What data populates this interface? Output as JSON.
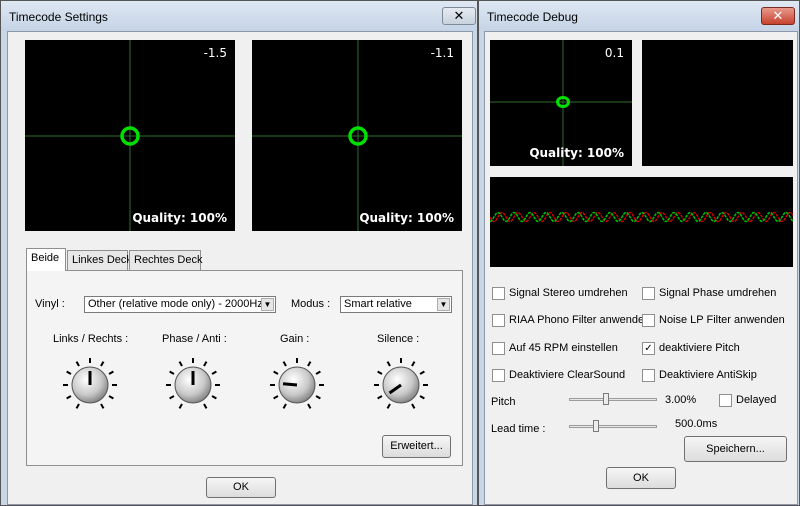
{
  "settings": {
    "title": "Timecode Settings",
    "close_glyph": "✕",
    "scope_left": {
      "value": "-1.5",
      "quality": "Quality: 100%"
    },
    "scope_right": {
      "value": "-1.1",
      "quality": "Quality: 100%"
    },
    "tabs": [
      "Beide",
      "Linkes Deck",
      "Rechtes Deck"
    ],
    "vinyl_label": "Vinyl :",
    "vinyl_value": "Other (relative mode only) - 2000Hz",
    "modus_label": "Modus :",
    "modus_value": "Smart relative",
    "knobs": [
      {
        "label": "Links / Rechts :"
      },
      {
        "label": "Phase / Anti :"
      },
      {
        "label": "Gain :"
      },
      {
        "label": "Silence :"
      }
    ],
    "advanced_button": "Erweitert...",
    "ok_button": "OK"
  },
  "debug": {
    "title": "Timecode Debug",
    "close_glyph": "✕",
    "scope": {
      "value": "0.1",
      "quality": "Quality: 100%"
    },
    "checkboxes": [
      {
        "label": "Signal Stereo umdrehen",
        "checked": false
      },
      {
        "label": "Signal Phase umdrehen",
        "checked": false
      },
      {
        "label": "RIAA Phono Filter anwenden",
        "checked": false
      },
      {
        "label": "Noise LP Filter anwenden",
        "checked": false
      },
      {
        "label": "Auf 45 RPM einstellen",
        "checked": false
      },
      {
        "label": "deaktiviere Pitch",
        "checked": true
      },
      {
        "label": "Deaktiviere ClearSound",
        "checked": false
      },
      {
        "label": "Deaktiviere AntiSkip",
        "checked": false
      }
    ],
    "pitch_label": "Pitch",
    "pitch_value": "3.00%",
    "delayed_label": "Delayed",
    "delayed_checked": false,
    "lead_label": "Lead time :",
    "lead_value": "500.0ms",
    "save_button": "Speichern...",
    "ok_button": "OK"
  },
  "colors": {
    "scope_bg": "#000000",
    "scope_grid": "#2e6e2e",
    "scope_ring": "#00e000",
    "wave_red": "#d00000",
    "wave_green": "#00c000"
  }
}
